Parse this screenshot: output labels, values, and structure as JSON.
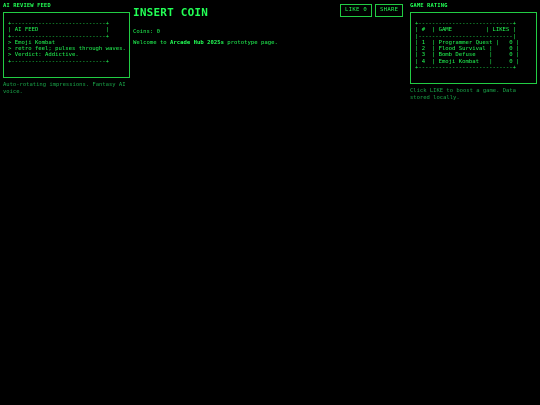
{
  "left": {
    "title": "AI REVIEW FEED",
    "panel_text": "+----------------------------+\n| AI FEED                    |\n+----------------------------+\n> Emoji Kombat\n> retro feel; pulses through waves.\n> Verdict: Addictive.\n+----------------------------+",
    "note": "Auto-rotating impressions. Fantasy AI voice."
  },
  "center": {
    "title": "INSERT COIN",
    "coins": "Coins: 0",
    "welcome_prefix": "Welcome to ",
    "welcome_brand": "Arcade Hub 2025s",
    "welcome_suffix": " prototype page."
  },
  "toolbar": {
    "like_label": "LIKE 0",
    "share_label": "SHARE"
  },
  "right": {
    "title": "GAME RATING",
    "panel_text": "+----------------------------+\n| #  | GAME          | LIKES |\n|----------------------------|\n| 1  | Programmer Quest |   0 |\n| 2  | Flood Survival |     0 |\n| 3  | Bomb Defuse    |     0 |\n| 4  | Emoji Kombat   |     0 |\n+----------------------------+",
    "note": "Click LIKE to boost a game. Data stored locally."
  }
}
